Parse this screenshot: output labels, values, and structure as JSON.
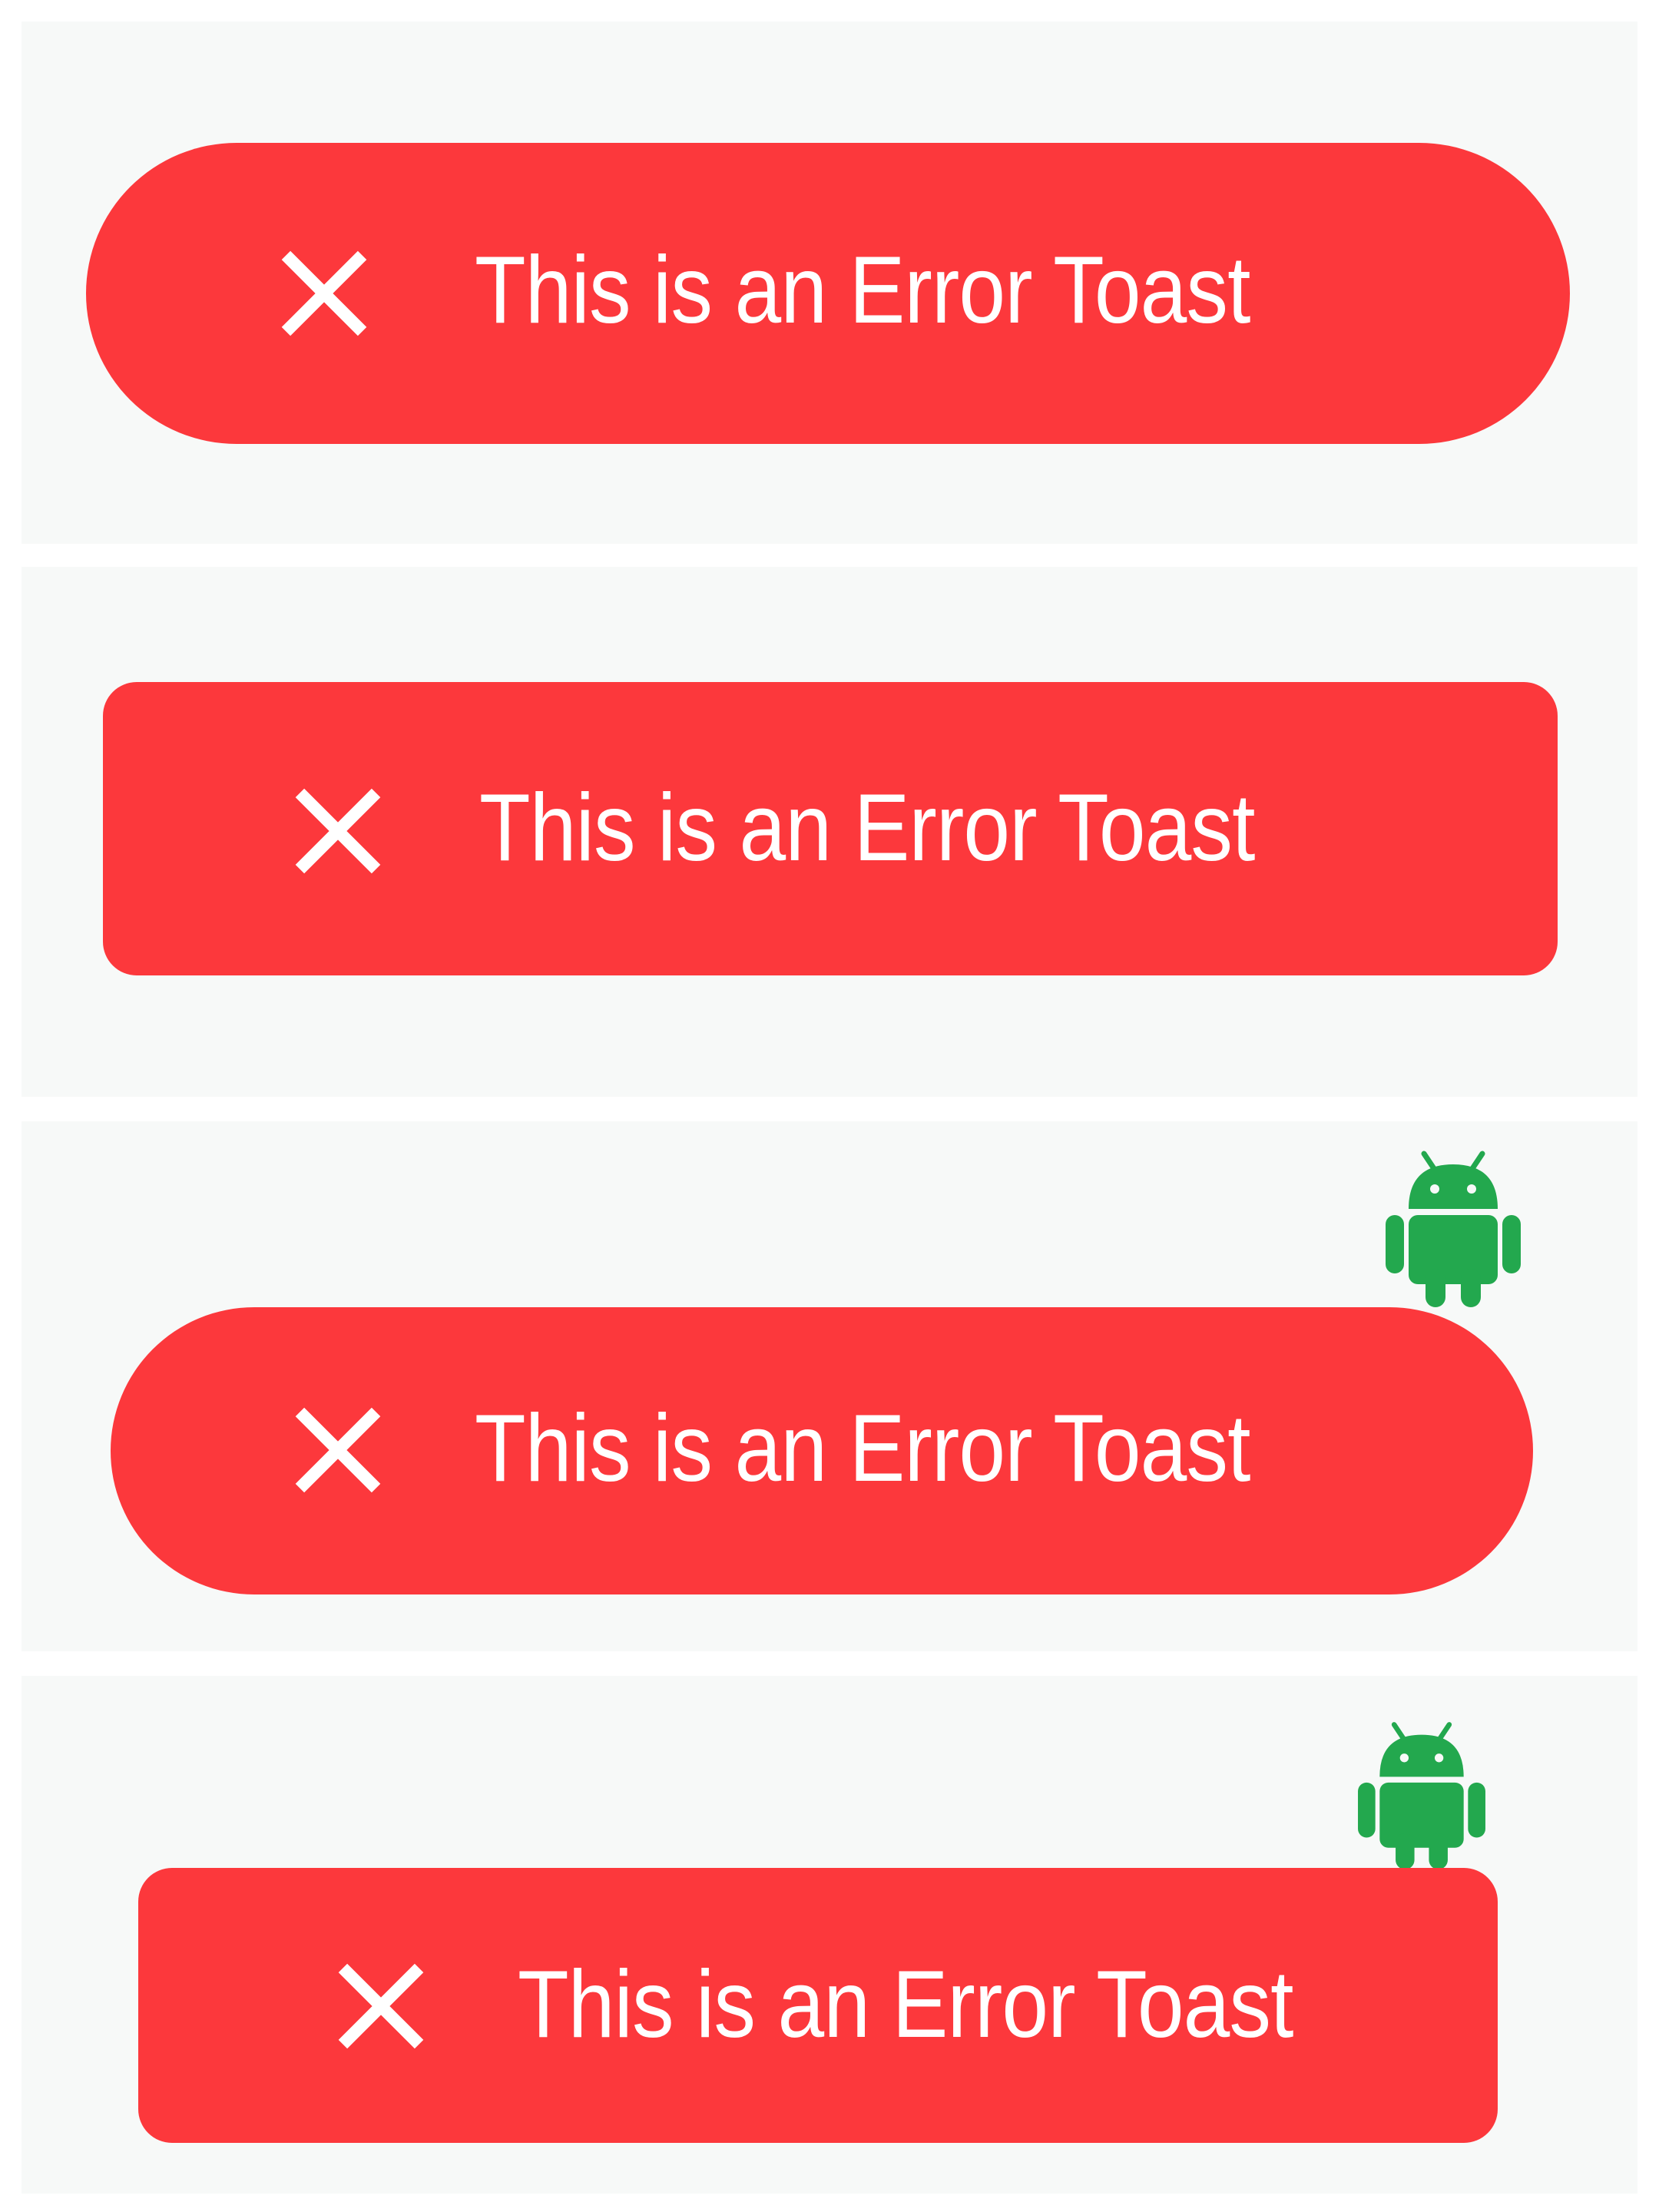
{
  "accent_color": "#fc383c",
  "android_color": "#23a84e",
  "toasts": [
    {
      "message": "This is an Error Toast",
      "shape": "pill",
      "icon": "close-icon",
      "has_android_badge": false
    },
    {
      "message": "This is an Error Toast",
      "shape": "rounded-rect",
      "icon": "close-icon",
      "has_android_badge": false
    },
    {
      "message": "This is an Error Toast",
      "shape": "pill",
      "icon": "close-icon",
      "has_android_badge": true,
      "badge_icon": "android-icon"
    },
    {
      "message": "This is an Error Toast",
      "shape": "rounded-rect",
      "icon": "close-icon",
      "has_android_badge": true,
      "badge_icon": "android-icon"
    }
  ]
}
